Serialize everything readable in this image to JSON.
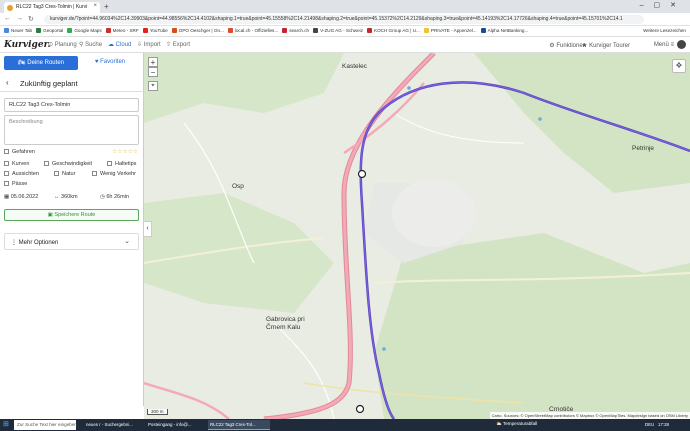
{
  "browser": {
    "tab_title": "RLC22 Tag3 Cres-Tolmin | Kurvi",
    "url": "kurviger.de/?point=44.96034%2C14.39903&point=44.98556%2C14.4102&shaping.1=true&point=45.15558%2C14.21498&shaping.2=true&point=45.15372%2C14.2129&shaping.3=true&point=45.14193%2C14.17726&shaping.4=true&point=45.15701%2C14.1",
    "bookmarks": [
      {
        "label": "Neuer Tab",
        "color": "#4a87e5"
      },
      {
        "label": "Geoportal",
        "color": "#2d7a3f"
      },
      {
        "label": "Google Maps",
        "color": "#34a853"
      },
      {
        "label": "Meteo - SRF",
        "color": "#c9302c"
      },
      {
        "label": "YouTube",
        "color": "#e62117"
      },
      {
        "label": "OPO Oeschger | On...",
        "color": "#d94c1a"
      },
      {
        "label": "local.ch - Offizielles...",
        "color": "#e14b2f"
      },
      {
        "label": "search.ch",
        "color": "#cc1f2f"
      },
      {
        "label": "V-ZUG AG - Schweiz",
        "color": "#444444"
      },
      {
        "label": "KOCH Group AG | U...",
        "color": "#c2272d"
      },
      {
        "label": "PRIVATE - Appenzel...",
        "color": "#f2c230"
      },
      {
        "label": "Alpha NetBanking...",
        "color": "#1a4d8f"
      }
    ],
    "other_bookmarks": "Weitere Lesezeichen"
  },
  "header": {
    "logo": "Kurviger.",
    "menu": [
      "Planung",
      "Suche",
      "Cloud",
      "Import",
      "Export"
    ],
    "active_menu": "Cloud",
    "right": {
      "functions": "Funktionen",
      "tourer": "Kurviger Tourer",
      "menu": "Menü"
    }
  },
  "sidebar": {
    "btn_routes": "Deine Routen",
    "btn_favorites": "Favoriten",
    "plan_title": "Zukünftig geplant",
    "route_name": "RLC22 Tag3 Cres-Tolmin",
    "description_placeholder": "Beschreibung",
    "driven_label": "Gefahren",
    "stars": "☆☆☆☆☆",
    "checkboxes": [
      "Kurven",
      "Geschwindigkeit",
      "Haltetips",
      "Aussichten",
      "Natur",
      "Wenig Verkehr",
      "Pässe"
    ],
    "date": "05.06.2022",
    "distance": "360km",
    "duration": "6h 26min",
    "save_label": "Speichere Route",
    "more_options": "Mehr Optionen"
  },
  "map": {
    "labels": [
      {
        "text": "Kastelec",
        "kind": "town"
      },
      {
        "text": "Petrinje",
        "kind": "town"
      },
      {
        "text": "Osp",
        "kind": "town"
      },
      {
        "text": "Gabrovica pri\nČrnem Kalu",
        "kind": "town"
      },
      {
        "text": "Crnotiče",
        "kind": "town"
      }
    ],
    "scale": "300 m",
    "attribution": "Carto. Sources: © OpenStreetMap contributors © Mapbox © OpenMapTiles. Mapdesign based on OSM Liberty"
  },
  "taskbar": {
    "search_placeholder": "Zur Suche Text hier eingeben",
    "items": [
      "neues r - Suchergebni...",
      "Posteingang - info@...",
      "RLC22 Tag3 Cres-Tol..."
    ],
    "weather": "Temperaturabfall",
    "lang": "DEU",
    "time": "17:28"
  }
}
